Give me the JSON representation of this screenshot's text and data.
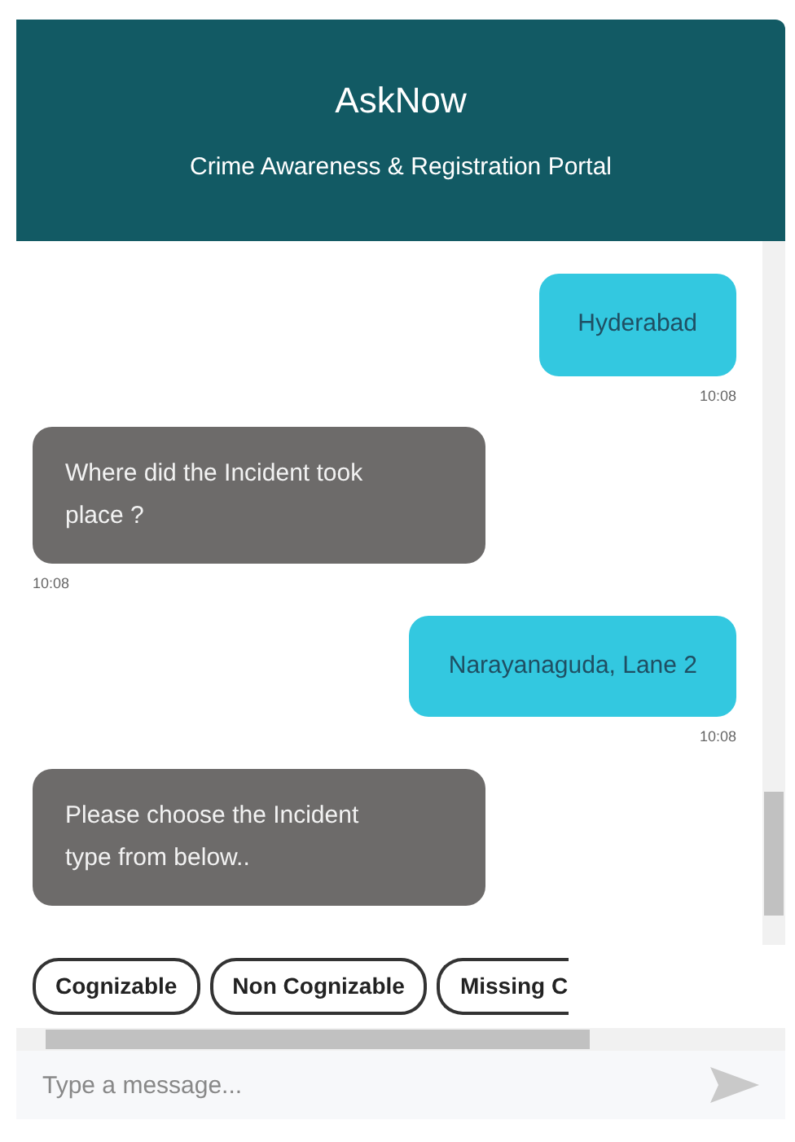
{
  "header": {
    "title": "AskNow",
    "subtitle": "Crime Awareness & Registration Portal"
  },
  "messages": [
    {
      "kind": "user",
      "text": "Hyderabad",
      "time": "10:08"
    },
    {
      "kind": "bot",
      "text": "Where did the Incident took place ?",
      "time": "10:08"
    },
    {
      "kind": "user",
      "text": "Narayanaguda, Lane 2",
      "time": "10:08"
    },
    {
      "kind": "bot",
      "text": "Please choose the Incident type from below.."
    }
  ],
  "quick_replies": [
    "Cognizable",
    "Non Cognizable",
    "Missing C"
  ],
  "composer": {
    "placeholder": "Type a message..."
  }
}
